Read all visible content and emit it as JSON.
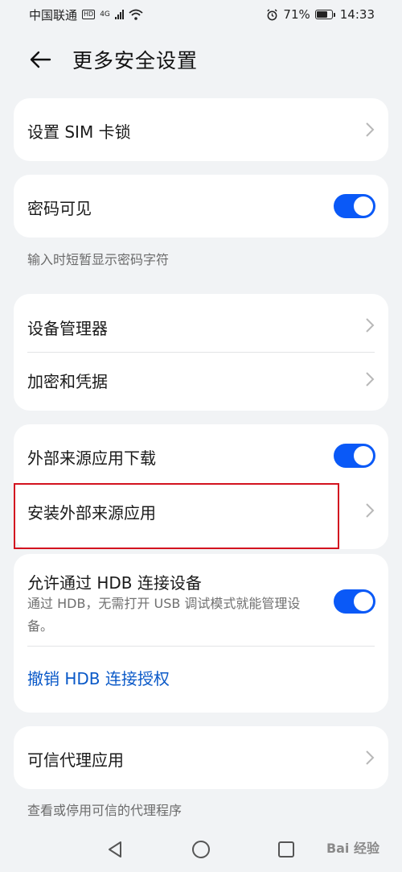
{
  "status_bar": {
    "carrier": "中国联通",
    "network_badge": "HD",
    "signal_text": "4G",
    "battery_percent": "71%",
    "battery_level": 0.71,
    "time": "14:33",
    "icons": [
      "signal-icon",
      "wifi-icon",
      "alarm-icon",
      "battery-icon"
    ]
  },
  "header": {
    "title": "更多安全设置",
    "back_icon": "arrow-left-icon"
  },
  "sections": {
    "sim_lock": {
      "label": "设置 SIM 卡锁"
    },
    "password_visible": {
      "label": "密码可见",
      "enabled": true,
      "caption": "输入时短暂显示密码字符"
    },
    "device_admin": {
      "label": "设备管理器"
    },
    "credentials": {
      "label": "加密和凭据"
    },
    "external_download": {
      "label": "外部来源应用下载",
      "enabled": true
    },
    "install_external": {
      "label": "安装外部来源应用"
    },
    "hdb": {
      "label": "允许通过 HDB 连接设备",
      "sub": "通过 HDB，无需打开 USB 调试模式就能管理设备。",
      "enabled": true,
      "revoke": "撤销 HDB 连接授权"
    },
    "trust_agents": {
      "label": "可信代理应用",
      "caption": "查看或停用可信的代理程序"
    }
  },
  "navbar": {
    "icons": [
      "nav-back-icon",
      "nav-home-icon",
      "nav-recents-icon"
    ]
  },
  "watermark": "Bai 经验",
  "colors": {
    "accent": "#0a59f7",
    "link": "#0a59c8",
    "highlight": "#d3131f",
    "background": "#f1f3f5"
  }
}
